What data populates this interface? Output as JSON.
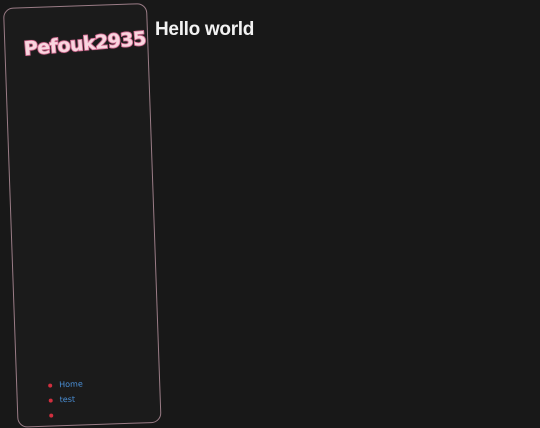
{
  "sidebar": {
    "logo_text": "Pefouk2935",
    "nav_items": [
      {
        "label": "Home"
      },
      {
        "label": "test"
      },
      {
        "label": ""
      }
    ]
  },
  "main": {
    "title": "Hello world"
  },
  "colors": {
    "background": "#181818",
    "sidebar_border": "#9a7c86",
    "logo_fill": "#f8d6df",
    "logo_outline": "#e0779e",
    "link": "#4a8fd6",
    "bullet": "#d12f3e",
    "title": "#f2f2f2"
  }
}
